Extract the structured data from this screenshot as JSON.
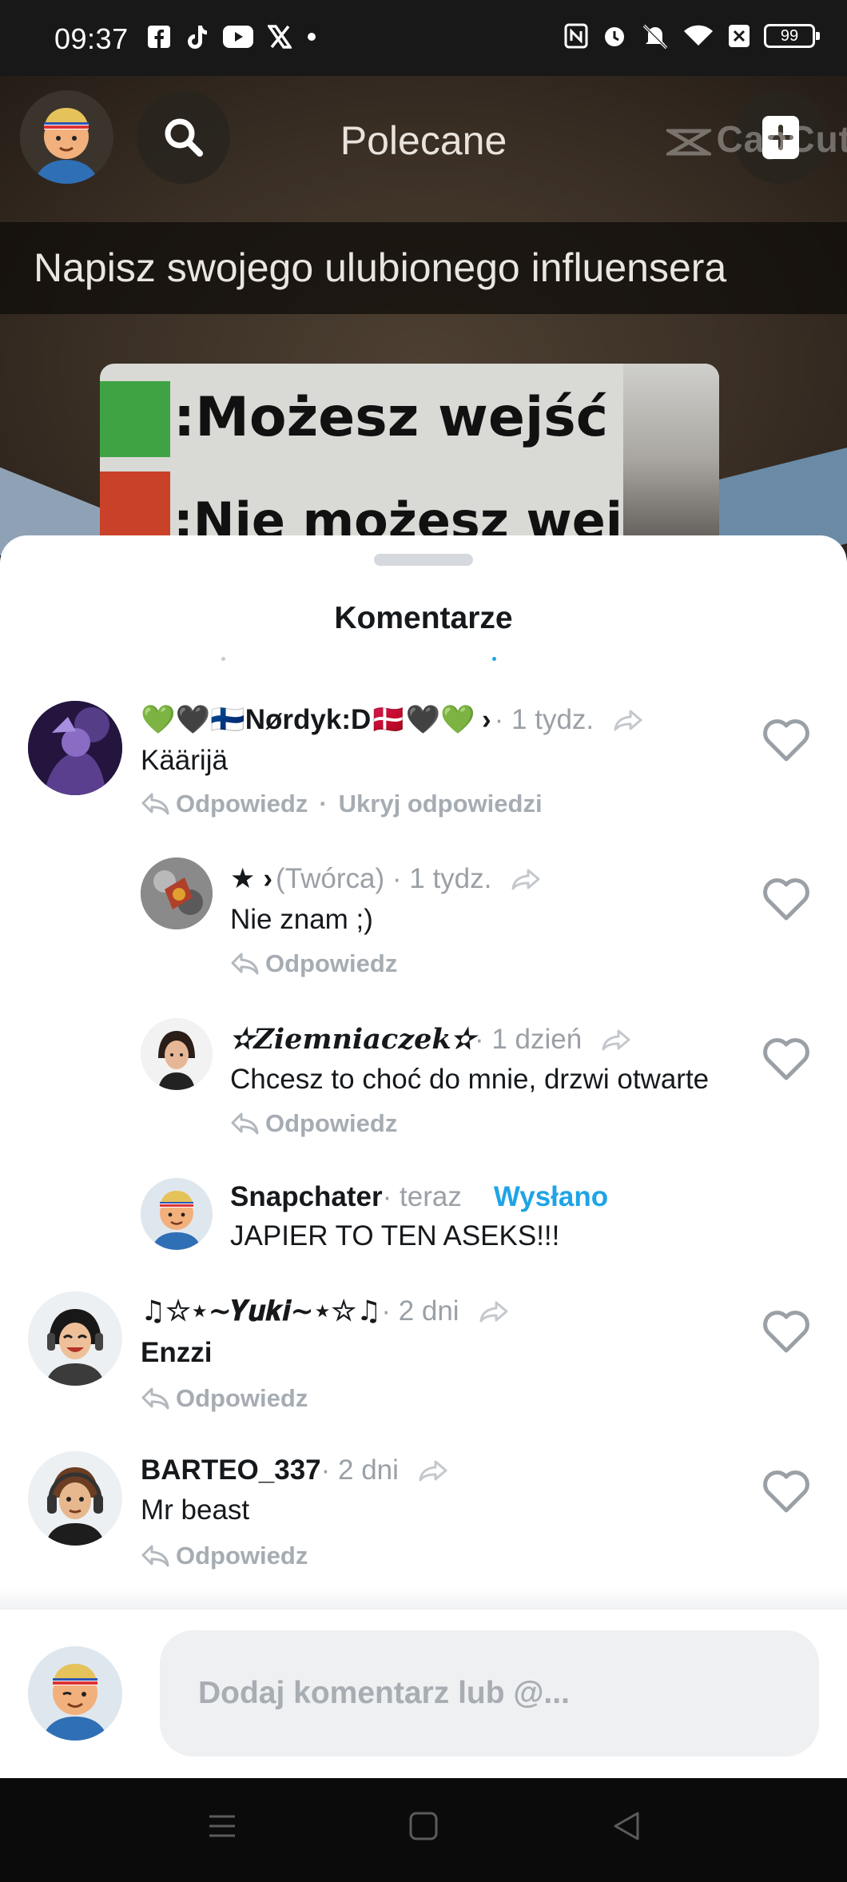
{
  "status_bar": {
    "time": "09:37",
    "battery": "99",
    "icons": [
      "facebook-icon",
      "tiktok-icon",
      "youtube-icon",
      "x-icon",
      "dot-icon",
      "nfc-icon",
      "alarm-icon",
      "mute-icon",
      "wifi-icon",
      "sim-off-icon"
    ]
  },
  "video": {
    "watermark": "CapCut",
    "nav_title": "Polecane",
    "caption": "Napisz swojego ulubionego influensera",
    "meme_line_1": ":Możesz wejść",
    "meme_line_2": ":Nie możesz wejść"
  },
  "sheet": {
    "title": "Komentarze",
    "reply_label": "Odpowiedz",
    "hide_replies_label": "Ukryj odpowiedzi",
    "separator": "·"
  },
  "comments": [
    {
      "name": "💚🖤🇫🇮Nørdyk:D🇩🇰🖤💚",
      "chevron": "›",
      "meta": " · 1 tydz.",
      "text": "Käärijä",
      "liked": false
    },
    {
      "name": "★",
      "chevron": "›",
      "meta": " (Twórca) · 1 tydz.",
      "text": "Nie znam ;)",
      "liked": false
    },
    {
      "name": "✫𝒁𝒊𝒆𝒎𝒏𝒊𝒂𝒄𝒛𝒆𝒌✫",
      "meta": " · 1 dzień",
      "text": "Chcesz to choć do mnie, drzwi otwarte",
      "liked": false
    },
    {
      "name": "Snapchater",
      "meta": " · teraz",
      "status": "Wysłano",
      "text": "JAPIER TO TEN ASEKS!!!"
    },
    {
      "name": "♫☆⋆~𝒀𝒖𝒌𝒊~⋆☆♫",
      "meta": " · 2 dni",
      "text": "Enzzi",
      "liked": false
    },
    {
      "name": "BARTEO_337",
      "meta": " · 2 dni",
      "text": "Mr beast",
      "liked": false
    }
  ],
  "composer": {
    "placeholder": "Dodaj komentarz lub @..."
  },
  "colors": {
    "accent_blue": "#1ea4e6",
    "meta_gray": "#9aa0a6",
    "text_dark": "#16191c"
  }
}
